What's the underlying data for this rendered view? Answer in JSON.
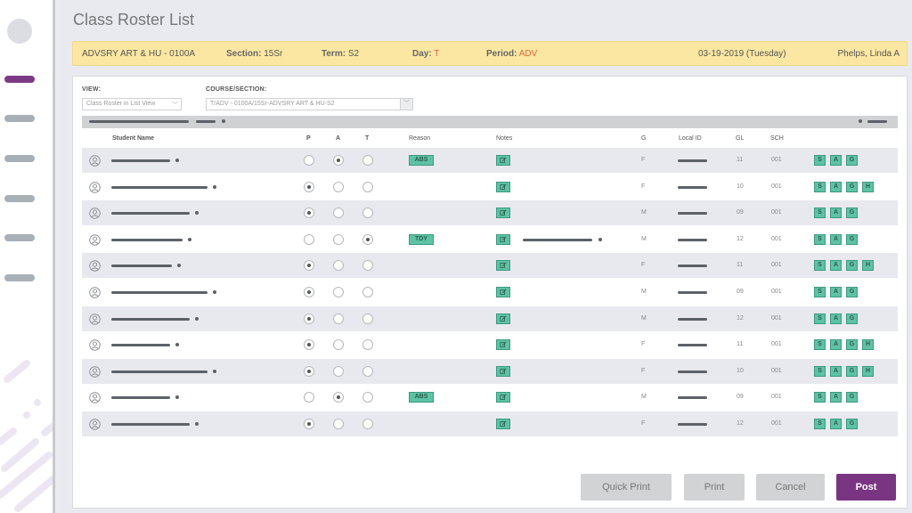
{
  "sidebar": {
    "items": [
      {
        "name": "nav-item-1",
        "active": true
      },
      {
        "name": "nav-item-2",
        "active": false
      },
      {
        "name": "nav-item-3",
        "active": false
      },
      {
        "name": "nav-item-4",
        "active": false
      },
      {
        "name": "nav-item-5",
        "active": false
      },
      {
        "name": "nav-item-6",
        "active": false
      }
    ]
  },
  "page": {
    "title": "Class Roster List"
  },
  "info": {
    "course": "ADVSRY ART & HU - 0100A",
    "section_label": "Section:",
    "section": "15Sr",
    "term_label": "Term:",
    "term": "S2",
    "day_label": "Day:",
    "day": "T",
    "period_label": "Period:",
    "period": "ADV",
    "date": "03-19-2019 (Tuesday)",
    "teacher": "Phelps, Linda A"
  },
  "filters": {
    "view_label": "VIEW:",
    "view_value": "Class Roster in List View",
    "course_label": "COURSE/SECTION:",
    "course_value": "T/ADV - 0100A/15Sr-ADVSRY ART & HU-S2"
  },
  "columns": {
    "name": "Student Name",
    "p": "P",
    "a": "A",
    "t": "T",
    "reason": "Reason",
    "notes": "Notes",
    "g": "G",
    "local_id": "Local ID",
    "gl": "GL",
    "sch": "SCH"
  },
  "rows": [
    {
      "attendance": "A",
      "reason": "ABS",
      "note_text": false,
      "gender": "F",
      "gl": "11",
      "sch": "001",
      "tags": [
        "S",
        "A",
        "G"
      ]
    },
    {
      "attendance": "P",
      "reason": "",
      "note_text": false,
      "gender": "F",
      "gl": "10",
      "sch": "001",
      "tags": [
        "S",
        "A",
        "G",
        "H"
      ]
    },
    {
      "attendance": "P",
      "reason": "",
      "note_text": false,
      "gender": "M",
      "gl": "09",
      "sch": "001",
      "tags": [
        "S",
        "A",
        "G"
      ]
    },
    {
      "attendance": "T",
      "reason": "TDY",
      "note_text": true,
      "gender": "M",
      "gl": "12",
      "sch": "001",
      "tags": [
        "S",
        "A",
        "G"
      ]
    },
    {
      "attendance": "P",
      "reason": "",
      "note_text": false,
      "gender": "F",
      "gl": "11",
      "sch": "001",
      "tags": [
        "S",
        "A",
        "G",
        "H"
      ]
    },
    {
      "attendance": "P",
      "reason": "",
      "note_text": false,
      "gender": "M",
      "gl": "09",
      "sch": "001",
      "tags": [
        "S",
        "A",
        "G"
      ]
    },
    {
      "attendance": "P",
      "reason": "",
      "note_text": false,
      "gender": "M",
      "gl": "12",
      "sch": "001",
      "tags": [
        "S",
        "A",
        "G"
      ]
    },
    {
      "attendance": "P",
      "reason": "",
      "note_text": false,
      "gender": "F",
      "gl": "11",
      "sch": "001",
      "tags": [
        "S",
        "A",
        "G",
        "H"
      ]
    },
    {
      "attendance": "P",
      "reason": "",
      "note_text": false,
      "gender": "F",
      "gl": "10",
      "sch": "001",
      "tags": [
        "S",
        "A",
        "G",
        "H"
      ]
    },
    {
      "attendance": "A",
      "reason": "ABS",
      "note_text": false,
      "gender": "M",
      "gl": "09",
      "sch": "001",
      "tags": [
        "S",
        "A",
        "G"
      ]
    },
    {
      "attendance": "P",
      "reason": "",
      "note_text": false,
      "gender": "F",
      "gl": "12",
      "sch": "001",
      "tags": [
        "S",
        "A",
        "G"
      ]
    }
  ],
  "actions": {
    "quick_print": "Quick Print",
    "print": "Print",
    "cancel": "Cancel",
    "post": "Post"
  },
  "colors": {
    "accent": "#7a3582",
    "info_bar": "#fbe7a1",
    "badge": "#5cc3a4",
    "highlight": "#e0683f"
  }
}
